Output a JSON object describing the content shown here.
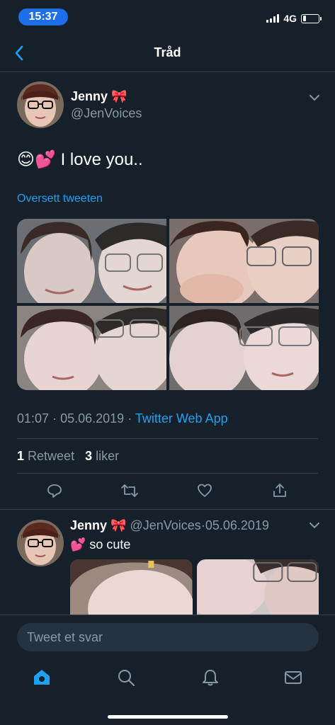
{
  "status_bar": {
    "time": "15:37",
    "network": "4G",
    "battery_level": 0.2
  },
  "nav": {
    "title": "Tråd"
  },
  "main_tweet": {
    "author_name": "Jenny",
    "author_emoji": "🎀",
    "handle": "@JenVoices",
    "text": "😊💕 I love you..",
    "translate_label": "Oversett tweeten",
    "time": "01:07",
    "date": "05.06.2019",
    "separator": "·",
    "source": "Twitter Web App",
    "retweet_count": "1",
    "retweet_label": "Retweet",
    "like_count": "3",
    "like_label": "liker"
  },
  "reply_tweet": {
    "author_name": "Jenny",
    "author_emoji": "🎀",
    "handle": "@JenVoices",
    "separator": "·",
    "date": "05.06.2019",
    "text": "💕 so cute"
  },
  "composer": {
    "placeholder": "Tweet et svar"
  },
  "tabs": [
    {
      "icon": "home-icon",
      "active": true
    },
    {
      "icon": "search-icon",
      "active": false
    },
    {
      "icon": "bell-icon",
      "active": false
    },
    {
      "icon": "mail-icon",
      "active": false
    }
  ],
  "colors": {
    "background": "#15202b",
    "accent": "#1da1f2",
    "muted": "#8899a6",
    "divider": "#38444d",
    "time_pill": "#1d6ee8"
  }
}
